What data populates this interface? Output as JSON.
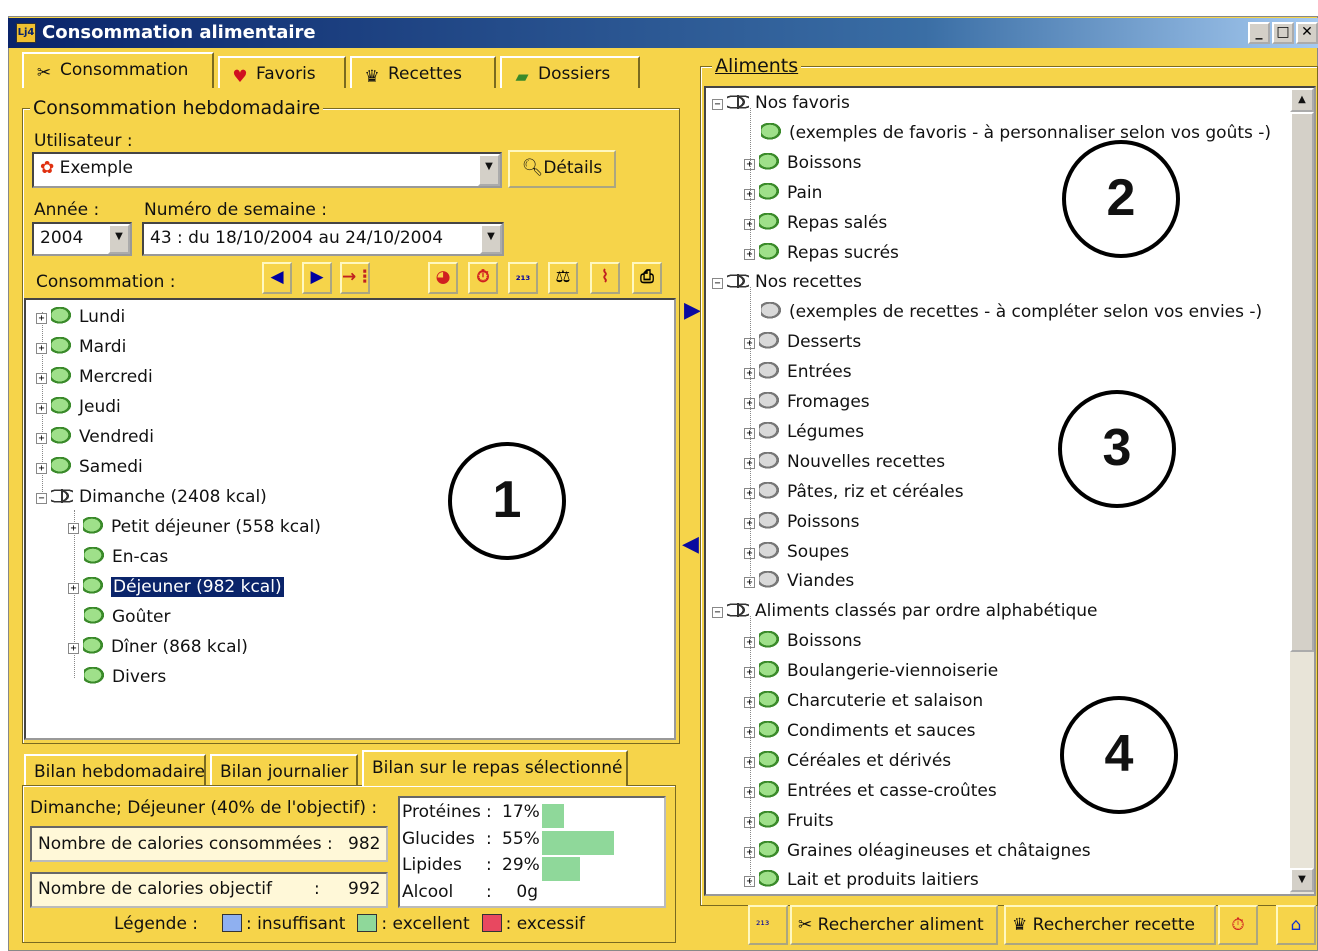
{
  "window": {
    "title": "Consommation alimentaire"
  },
  "tabs": [
    "Consommation",
    "Favoris",
    "Recettes",
    "Dossiers"
  ],
  "weekly": {
    "group_title": "Consommation hebdomadaire",
    "user_label": "Utilisateur :",
    "user_value": "Exemple",
    "details_button": "Détails",
    "year_label": "Année :",
    "year_value": "2004",
    "week_label": "Numéro de semaine :",
    "week_value": "43 : du 18/10/2004 au 24/10/2004",
    "consumption_label": "Consommation :"
  },
  "days": [
    {
      "label": "Lundi"
    },
    {
      "label": "Mardi"
    },
    {
      "label": "Mercredi"
    },
    {
      "label": "Jeudi"
    },
    {
      "label": "Vendredi"
    },
    {
      "label": "Samedi"
    },
    {
      "label": "Dimanche (2408 kcal)"
    }
  ],
  "meals": [
    {
      "label": "Petit déjeuner (558 kcal)"
    },
    {
      "label": "En-cas"
    },
    {
      "label": "Déjeuner (982 kcal)"
    },
    {
      "label": "Goûter"
    },
    {
      "label": "Dîner (868 kcal)"
    },
    {
      "label": "Divers"
    }
  ],
  "bilan_tabs": [
    "Bilan hebdomadaire",
    "Bilan journalier",
    "Bilan sur le repas sélectionné"
  ],
  "bilan": {
    "meal_title": "Dimanche; Déjeuner (40% de l'objectif) :",
    "consumed_label": "Nombre de calories consommées :",
    "consumed_value": "982",
    "target_label": "Nombre de calories objectif",
    "target_colon": ":",
    "target_value": "992",
    "nutrients": [
      {
        "name": "Protéines",
        "sep": ":",
        "value": "17%",
        "level": 0.17
      },
      {
        "name": "Glucides",
        "sep": ":",
        "value": "55%",
        "level": 0.55
      },
      {
        "name": "Lipides",
        "sep": ":",
        "value": "29%",
        "level": 0.29
      },
      {
        "name": "Alcool",
        "sep": ":",
        "value": "0g",
        "level": 0
      }
    ],
    "legend_title": "Légende :",
    "legend": [
      {
        "label": ": insuffisant",
        "color": "#8fb0f0"
      },
      {
        "label": ": excellent",
        "color": "#8fd89a"
      },
      {
        "label": ": excessif",
        "color": "#e84860"
      }
    ]
  },
  "aliments": {
    "group_title": "Aliments",
    "favoris": {
      "title": "Nos favoris",
      "items": [
        "(exemples de favoris - à personnaliser selon vos goûts -)",
        "Boissons",
        "Pain",
        "Repas salés",
        "Repas sucrés"
      ]
    },
    "recettes": {
      "title": "Nos recettes",
      "items": [
        "(exemples de recettes - à compléter selon vos envies -)",
        "Desserts",
        "Entrées",
        "Fromages",
        "Légumes",
        "Nouvelles recettes",
        "Pâtes, riz et céréales",
        "Poissons",
        "Soupes",
        "Viandes"
      ]
    },
    "alpha": {
      "title": "Aliments classés par ordre alphabétique",
      "items": [
        "Boissons",
        "Boulangerie-viennoiserie",
        "Charcuterie et salaison",
        "Condiments et sauces",
        "Céréales et dérivés",
        "Entrées et casse-croûtes",
        "Fruits",
        "Graines oléagineuses et châtaignes",
        "Lait et produits laitiers"
      ]
    }
  },
  "bottom_buttons": {
    "search_food": "Rechercher aliment",
    "search_recipe": "Rechercher recette"
  },
  "annotations": [
    "1",
    "2",
    "3",
    "4"
  ]
}
